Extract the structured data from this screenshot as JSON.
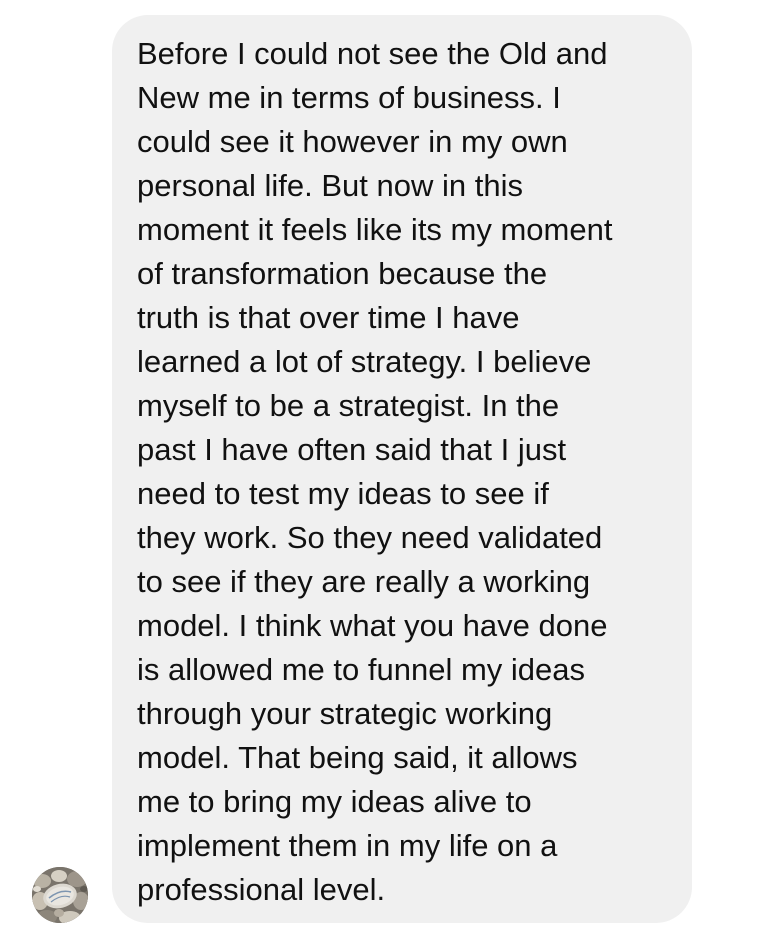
{
  "conversation": {
    "sender_avatar_icon": "stone-pebbles-avatar-icon",
    "message": {
      "lines": [
        "Before I could not see the Old and",
        "New me in terms of business. I",
        "could see it however in my own",
        "personal life. But now in this",
        "moment it feels like its my moment",
        "of transformation because the",
        "truth is that over time I have",
        "learned a lot of strategy. I believe",
        "myself to be a strategist. In the",
        "past I have often said that I just",
        "need to test my ideas to see if",
        "they work. So they need validated",
        "to see if they are really a working",
        "model. I think what you have done",
        "is allowed me to funnel my ideas",
        "through your strategic working",
        "model. That being said, it allows",
        "me to bring my ideas alive to",
        "implement them in my life on a",
        "professional level."
      ],
      "bubble_color": "#f0f0f0",
      "text_color": "#111111"
    }
  }
}
